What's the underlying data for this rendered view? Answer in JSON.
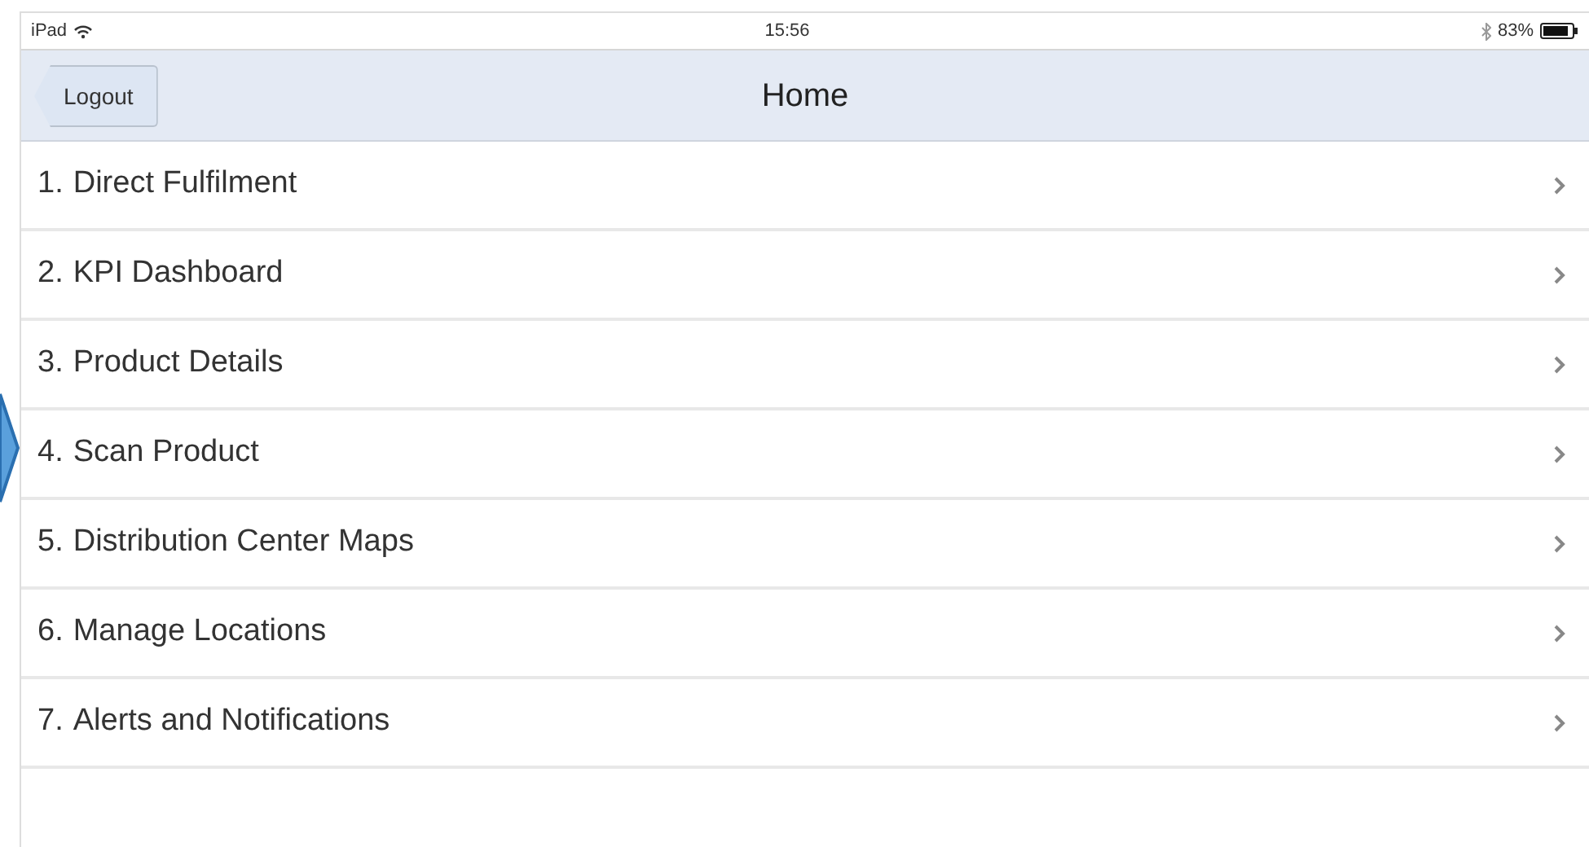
{
  "status_bar": {
    "device": "iPad",
    "time": "15:56",
    "battery": "83%"
  },
  "nav_bar": {
    "back_button": "Logout",
    "title": "Home"
  },
  "menu_items": [
    {
      "number": "1.",
      "label": "Direct Fulfilment"
    },
    {
      "number": "2.",
      "label": "KPI Dashboard"
    },
    {
      "number": "3.",
      "label": "Product Details"
    },
    {
      "number": "4.",
      "label": "Scan Product"
    },
    {
      "number": "5.",
      "label": "Distribution Center Maps"
    },
    {
      "number": "6.",
      "label": "Manage Locations"
    },
    {
      "number": "7.",
      "label": "Alerts and Notifications"
    }
  ]
}
